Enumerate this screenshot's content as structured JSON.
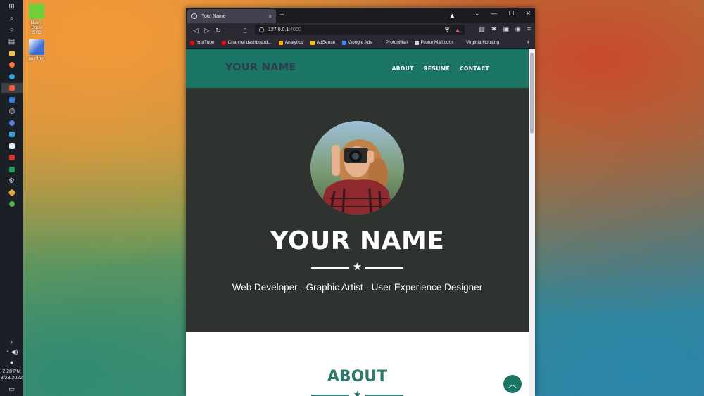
{
  "desktop": {
    "icons": [
      {
        "label": "Rob's Book 2022",
        "color": "#6fcf3a"
      },
      {
        "label": "paintnet",
        "color": "#3b6fd4"
      }
    ]
  },
  "taskbar": {
    "time": "2:28 PM",
    "date": "3/23/2022",
    "chevron": "›",
    "wifi_icon": "wifi-icon",
    "volume_icon": "volume-icon",
    "mic_icon": "mic-icon"
  },
  "browser": {
    "tab_title": "Your Name",
    "tab_close": "×",
    "new_tab": "+",
    "url_host": "127.0.0.1",
    "url_port": ":4000",
    "bookmarks": [
      {
        "label": "YouTube",
        "color": "#ff0000"
      },
      {
        "label": "Channel dashboard...",
        "color": "#ff0000"
      },
      {
        "label": "Analytics",
        "color": "#f9ab00"
      },
      {
        "label": "AdSense",
        "color": "#fbbc04"
      },
      {
        "label": "Google Ads",
        "color": "#4285f4"
      },
      {
        "label": "ProtonMail",
        "color": "#2b2a33"
      },
      {
        "label": "ProtonMail.com",
        "color": "#cfcfd8"
      },
      {
        "label": "Virginia Housing",
        "color": "#2b2a33"
      }
    ],
    "bookmarks_more": "»"
  },
  "site": {
    "brand": "YOUR NAME",
    "nav": [
      "ABOUT",
      "RESUME",
      "CONTACT"
    ],
    "hero_name": "YOUR NAME",
    "subtitle": "Web Developer - Graphic Artist - User Experience Designer",
    "about_title": "ABOUT",
    "star": "★",
    "to_top": "︿"
  },
  "colors": {
    "nav_bg": "#1a7565",
    "hero_bg": "#2e3330",
    "accent": "#2c7a6d"
  }
}
